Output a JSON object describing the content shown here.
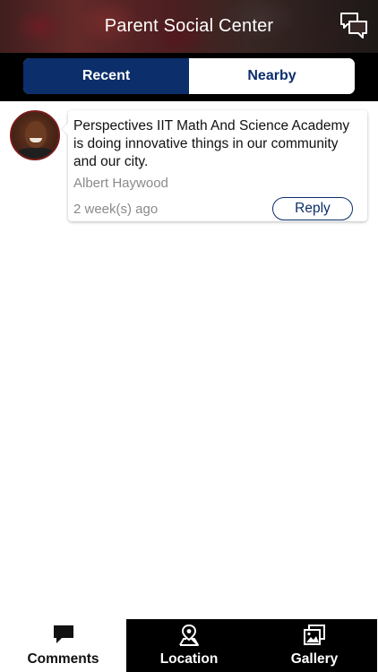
{
  "header": {
    "title": "Parent Social Center",
    "chat_icon": "chat-bubbles-icon"
  },
  "tabs": [
    {
      "label": "Recent",
      "active": true
    },
    {
      "label": "Nearby",
      "active": false
    }
  ],
  "comments": [
    {
      "text": "Perspectives IIT Math And Science Academy is doing innovative things in our community and our city.",
      "author": "Albert Haywood",
      "time": "2 week(s) ago",
      "reply_label": "Reply"
    }
  ],
  "bottom_nav": [
    {
      "label": "Comments",
      "icon": "comment-icon",
      "active": true
    },
    {
      "label": "Location",
      "icon": "map-pin-icon",
      "active": false
    },
    {
      "label": "Gallery",
      "icon": "gallery-icon",
      "active": false
    }
  ],
  "colors": {
    "accent": "#0c2e6b",
    "tabbar_bg": "#000000",
    "nav_inactive_bg": "#000000",
    "text_muted": "#8a8a8a"
  }
}
